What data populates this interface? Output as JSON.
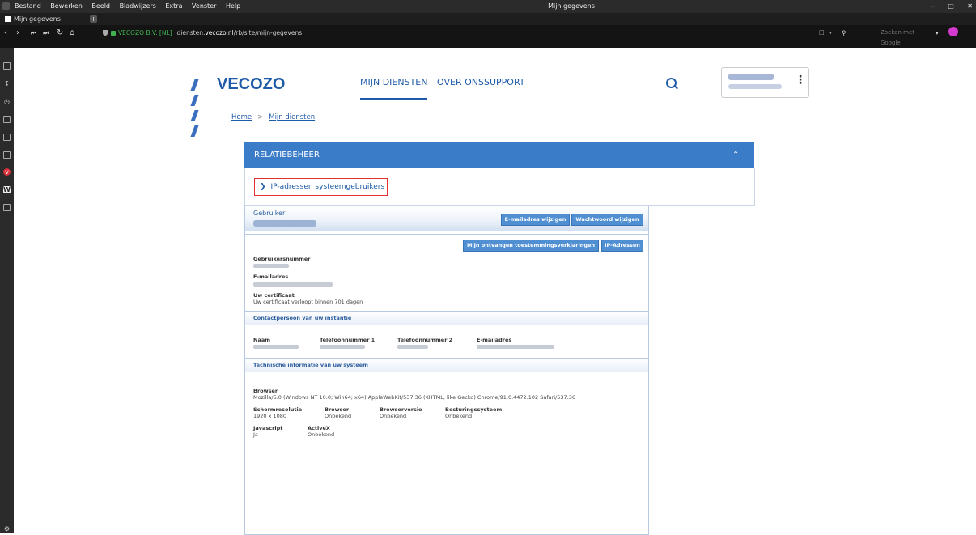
{
  "browser": {
    "menu": [
      "Bestand",
      "Bewerken",
      "Beeld",
      "Bladwijzers",
      "Extra",
      "Venster",
      "Help"
    ],
    "window_title": "Mijn gegevens",
    "tab_title": "Mijn gegevens",
    "address": {
      "org": "VECOZO B.V. [NL]",
      "url_prefix": "diensten.",
      "url_domain": "vecozo.nl",
      "url_path": "/rb/site/mijn-gegevens"
    },
    "search_placeholder": "Zoeken met Google"
  },
  "site": {
    "logo_text": "VECOZO",
    "nav": [
      "MIJN DIENSTEN",
      "OVER ONS",
      "SUPPORT"
    ],
    "breadcrumb": [
      "Home",
      "Mijn diensten"
    ],
    "breadcrumb_sep": ">"
  },
  "relatiebeheer": {
    "title": "RELATIEBEHEER",
    "link": "IP-adressen systeemgebruikers"
  },
  "account": {
    "user_label": "Gebruiker",
    "btn_email": "E-mailadres wijzigen",
    "btn_password": "Wachtwoord wijzigen",
    "btn_permissions": "Mijn ontvangen toestemmingsverklaringen",
    "btn_ip": "IP-Adressen",
    "user_number_label": "Gebruikersnummer",
    "email_label": "E-mailadres",
    "certificate_label": "Uw certificaat",
    "certificate_text": "Uw certificaat verloopt binnen 701 dagen",
    "contact_title": "Contactpersoon van uw instantie",
    "contact_cols": [
      "Naam",
      "Telefoonnummer 1",
      "Telefoonnummer 2",
      "E-mailadres"
    ],
    "tech_title": "Technische informatie van uw systeem",
    "browser_label": "Browser",
    "user_agent": "Mozilla/5.0 (Windows NT 10.0; Win64; x64) AppleWebKit/537.36 (KHTML, like Gecko) Chrome/91.0.4472.102 Safari/537.36",
    "tech_row1": [
      {
        "label": "Schermresolutie",
        "value": "1920 x 1080"
      },
      {
        "label": "Browser",
        "value": "Onbekend"
      },
      {
        "label": "Browserversie",
        "value": "Onbekend"
      },
      {
        "label": "Besturingssysteem",
        "value": "Onbekend"
      }
    ],
    "tech_row2": [
      {
        "label": "Javascript",
        "value": "Ja"
      },
      {
        "label": "ActiveX",
        "value": "Onbekend"
      }
    ]
  }
}
